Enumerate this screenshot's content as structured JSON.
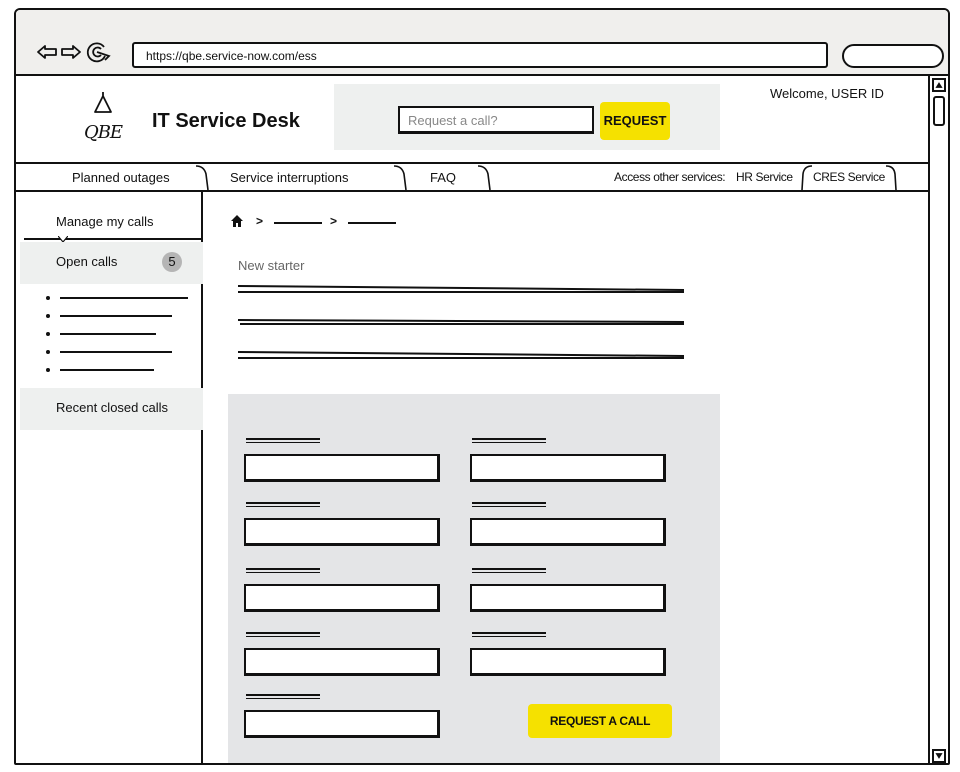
{
  "browser": {
    "url": "https://qbe.service-now.com/ess",
    "nav_icons": [
      "back-arrow-icon",
      "forward-arrow-icon",
      "refresh-icon"
    ]
  },
  "header": {
    "logo_text": "QBE",
    "site_title": "IT Service Desk",
    "search_placeholder": "Request a call?",
    "request_button": "REQUEST",
    "welcome": "Welcome, USER ID"
  },
  "tabs": {
    "items": [
      "Planned outages",
      "Service interruptions",
      "FAQ"
    ],
    "access_label": "Access other services:",
    "services": [
      "HR Service",
      "CRES Service"
    ]
  },
  "sidebar": {
    "manage_label": "Manage my calls",
    "open_calls_label": "Open calls",
    "open_calls_count": "5",
    "closed_calls_label": "Recent closed calls"
  },
  "main": {
    "page_title": "New starter",
    "request_call_button": "REQUEST A CALL"
  },
  "colors": {
    "accent": "#f5e100",
    "panel": "#e4e5e7",
    "header_search_bg": "#eef0ef",
    "sidebar_active": "#eef0ef",
    "browser_chrome": "#f0efed"
  }
}
